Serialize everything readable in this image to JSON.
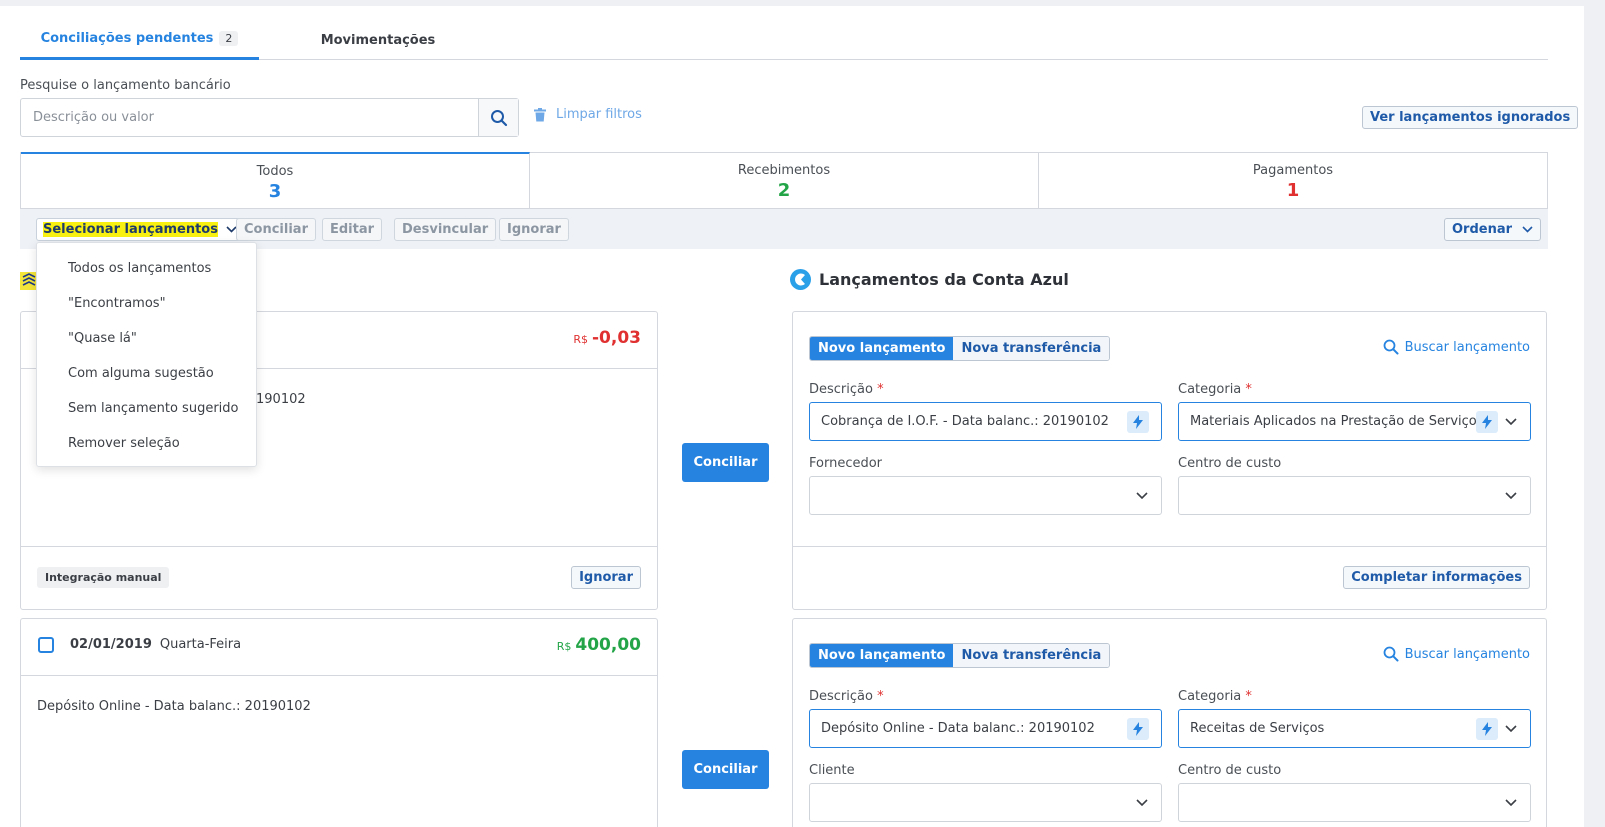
{
  "tabs": {
    "pending_label": "Conciliações pendentes",
    "pending_count": "2",
    "movements_label": "Movimentações"
  },
  "search": {
    "label": "Pesquise o lançamento bancário",
    "placeholder": "Descrição ou valor",
    "clear_filters": "Limpar filtros",
    "ignored_button": "Ver lançamentos ignorados"
  },
  "filter_tabs": [
    {
      "label": "Todos",
      "count": "3",
      "color": "#2684e0"
    },
    {
      "label": "Recebimentos",
      "count": "2",
      "color": "#22a447"
    },
    {
      "label": "Pagamentos",
      "count": "1",
      "color": "#e03030"
    }
  ],
  "actions": {
    "select": "Selecionar lançamentos",
    "conciliar": "Conciliar",
    "editar": "Editar",
    "desvincular": "Desvincular",
    "ignorar": "Ignorar",
    "ordenar": "Ordenar"
  },
  "dropdown": [
    "Todos os lançamentos",
    "\"Encontramos\"",
    "\"Quase lá\"",
    "Com alguma sugestão",
    "Sem lançamento sugerido",
    "Remover seleção"
  ],
  "bank": {
    "entry1": {
      "currency": "R$",
      "amount": "-0,03",
      "desc_visible": "190102",
      "tag": "Integração manual",
      "ignore": "Ignorar"
    },
    "entry2": {
      "date": "02/01/2019",
      "weekday": "Quarta-Feira",
      "currency": "R$",
      "amount": "400,00",
      "desc": "Depósito Online - Data balanc.: 20190102"
    }
  },
  "conciliar_button": "Conciliar",
  "conta_azul": {
    "title": "Lançamentos da Conta Azul",
    "entries": [
      {
        "new": "Novo lançamento",
        "transfer": "Nova transferência",
        "find": "Buscar lançamento",
        "desc_label": "Descrição",
        "desc_value": "Cobrança de I.O.F. - Data balanc.: 20190102",
        "cat_label": "Categoria",
        "cat_value": "Materiais Aplicados na Prestação de Serviços",
        "party_label": "Fornecedor",
        "cost_label": "Centro de custo",
        "complete": "Completar informações"
      },
      {
        "new": "Novo lançamento",
        "transfer": "Nova transferência",
        "find": "Buscar lançamento",
        "desc_label": "Descrição",
        "desc_value": "Depósito Online - Data balanc.: 20190102",
        "cat_label": "Categoria",
        "cat_value": "Receitas de Serviços",
        "party_label": "Cliente",
        "cost_label": "Centro de custo"
      }
    ]
  },
  "required_mark": "*"
}
